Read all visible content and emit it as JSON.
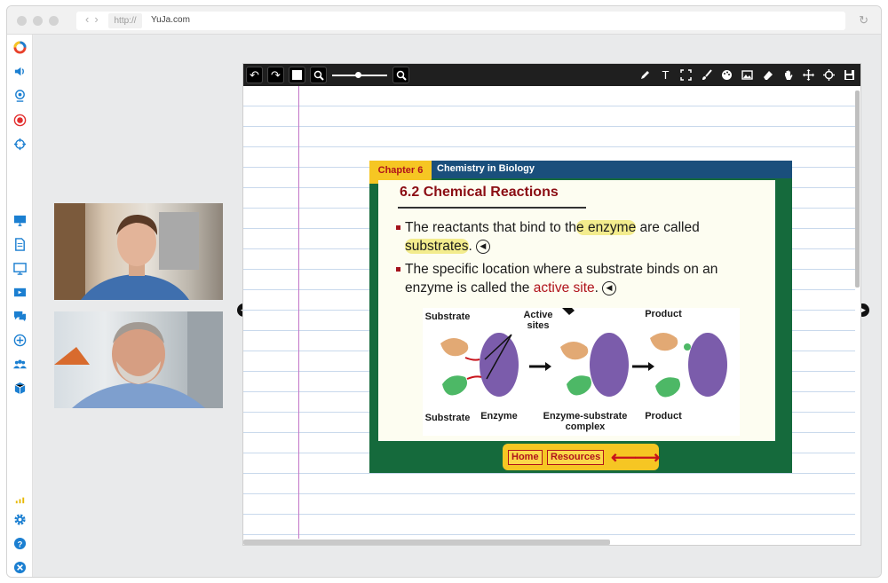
{
  "browser": {
    "url_protocol": "http://",
    "url_host": "YuJa.com",
    "nav_back": "‹",
    "nav_forward": "›",
    "reload_icon": "↻"
  },
  "sidebar": {
    "items": [
      {
        "name": "yuja-logo-icon",
        "color": "#e8412b"
      },
      {
        "name": "speaker-icon",
        "color": "#1b7fd1"
      },
      {
        "name": "webcam-icon",
        "color": "#1b7fd1"
      },
      {
        "name": "record-icon",
        "color": "#e22d2d"
      },
      {
        "name": "crosshair-icon",
        "color": "#1b7fd1"
      },
      {
        "name": "monitor-icon",
        "color": "#1b7fd1"
      },
      {
        "name": "document-icon",
        "color": "#1b7fd1"
      },
      {
        "name": "whiteboard-icon",
        "color": "#1b7fd1"
      },
      {
        "name": "video-icon",
        "color": "#1b7fd1"
      },
      {
        "name": "chat-icon",
        "color": "#1b7fd1"
      },
      {
        "name": "add-icon",
        "color": "#1b7fd1"
      },
      {
        "name": "participants-icon",
        "color": "#1b7fd1"
      },
      {
        "name": "box-icon",
        "color": "#1b7fd1"
      },
      {
        "name": "signal-icon",
        "color": "#e8b800"
      },
      {
        "name": "settings-icon",
        "color": "#1b7fd1"
      },
      {
        "name": "help-icon",
        "color": "#1b7fd1"
      },
      {
        "name": "close-icon",
        "color": "#1b7fd1"
      }
    ]
  },
  "toolbar": {
    "undo": "↶",
    "redo": "↷",
    "zoom_out": "🔍",
    "zoom_in": "🔍",
    "zoom_level": 0.5,
    "tools_right": [
      "pencil-icon",
      "text-icon",
      "select-icon",
      "brush-icon",
      "palette-icon",
      "image-icon",
      "eraser-icon",
      "hand-icon",
      "move-icon",
      "crosshair-icon",
      "save-icon"
    ],
    "text_tool": "T"
  },
  "slide": {
    "chapter": "Chapter 6",
    "chapter_title": "Chemistry in Biology",
    "title": "6.2 Chemical Reactions",
    "bullet1_a": "The reactants that bind to th",
    "bullet1_hl": "e enzyme",
    "bullet1_b": " are called",
    "bullet1_c": "substrates",
    "bullet1_d": ".",
    "bullet2_a": "The specific location where a substrate binds on an",
    "bullet2_b": "enzyme is called the ",
    "bullet2_red": "active site",
    "bullet2_c": ".",
    "speaker_glyph": "◀",
    "diagram": {
      "substrate_top": "Substrate",
      "active_sites": "Active sites",
      "product_top": "Product",
      "substrate_bottom": "Substrate",
      "enzyme": "Enzyme",
      "complex": "Enzyme-substrate complex",
      "product_bottom": "Product"
    },
    "nav": {
      "home": "Home",
      "resources": "Resources",
      "arrows": "⟵⟶"
    }
  },
  "page_nav": {
    "prev": "◀",
    "next": "▶"
  }
}
